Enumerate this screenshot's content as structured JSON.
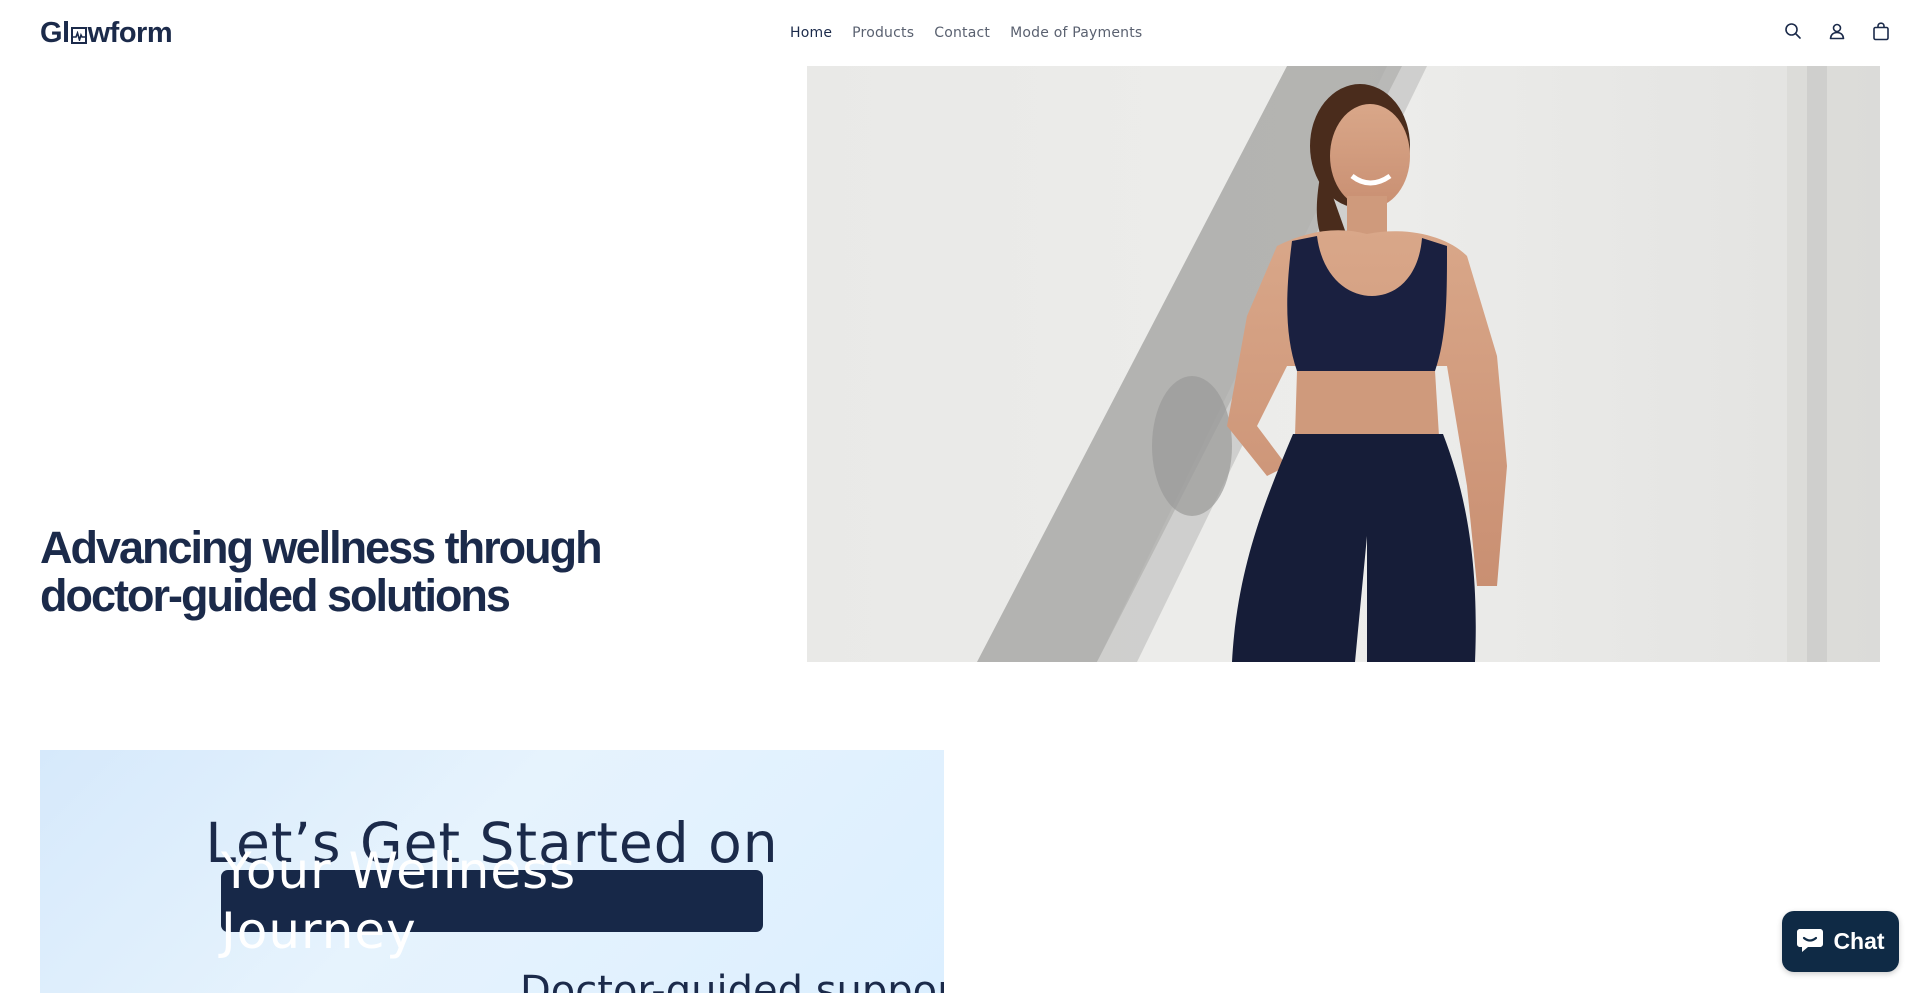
{
  "header": {
    "logo_text_left": "Gl",
    "logo_text_right": "wform",
    "nav": [
      {
        "label": "Home",
        "active": true
      },
      {
        "label": "Products",
        "active": false
      },
      {
        "label": "Contact",
        "active": false
      },
      {
        "label": "Mode of Payments",
        "active": false
      }
    ],
    "icons": [
      "search-icon",
      "account-icon",
      "cart-icon"
    ]
  },
  "hero": {
    "heading": "Advancing wellness through doctor-guided solutions"
  },
  "banner": {
    "line1": "Let’s Get Started on",
    "line2": "Your Wellness Journey",
    "line3": "Doctor-guided support"
  },
  "chat": {
    "label": "Chat",
    "icon": "chat-bubble-icon"
  },
  "colors": {
    "brand_navy": "#1b2a4a",
    "nav_text": "#5a6170",
    "banner_bg": "#dcefff",
    "chat_bg": "#0f2a45"
  }
}
